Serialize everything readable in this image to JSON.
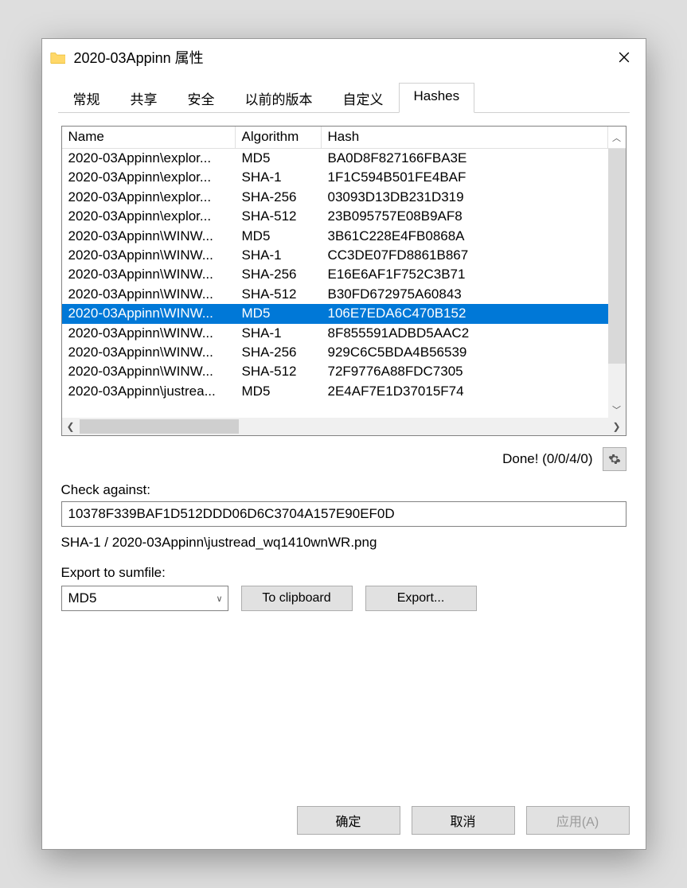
{
  "window": {
    "title": "2020-03Appinn 属性"
  },
  "tabs": [
    "常规",
    "共享",
    "安全",
    "以前的版本",
    "自定义",
    "Hashes"
  ],
  "active_tab_index": 5,
  "list": {
    "headers": {
      "name": "Name",
      "algorithm": "Algorithm",
      "hash": "Hash"
    },
    "selected_index": 8,
    "rows": [
      {
        "name": "2020-03Appinn\\explor...",
        "alg": "MD5",
        "hash": "BA0D8F827166FBA3E"
      },
      {
        "name": "2020-03Appinn\\explor...",
        "alg": "SHA-1",
        "hash": "1F1C594B501FE4BAF"
      },
      {
        "name": "2020-03Appinn\\explor...",
        "alg": "SHA-256",
        "hash": "03093D13DB231D319"
      },
      {
        "name": "2020-03Appinn\\explor...",
        "alg": "SHA-512",
        "hash": "23B095757E08B9AF8"
      },
      {
        "name": "2020-03Appinn\\WINW...",
        "alg": "MD5",
        "hash": "3B61C228E4FB0868A"
      },
      {
        "name": "2020-03Appinn\\WINW...",
        "alg": "SHA-1",
        "hash": "CC3DE07FD8861B867"
      },
      {
        "name": "2020-03Appinn\\WINW...",
        "alg": "SHA-256",
        "hash": "E16E6AF1F752C3B71"
      },
      {
        "name": "2020-03Appinn\\WINW...",
        "alg": "SHA-512",
        "hash": "B30FD672975A60843"
      },
      {
        "name": "2020-03Appinn\\WINW...",
        "alg": "MD5",
        "hash": "106E7EDA6C470B152"
      },
      {
        "name": "2020-03Appinn\\WINW...",
        "alg": "SHA-1",
        "hash": "8F855591ADBD5AAC2"
      },
      {
        "name": "2020-03Appinn\\WINW...",
        "alg": "SHA-256",
        "hash": "929C6C5BDA4B56539"
      },
      {
        "name": "2020-03Appinn\\WINW...",
        "alg": "SHA-512",
        "hash": "72F9776A88FDC7305"
      },
      {
        "name": "2020-03Appinn\\justrea...",
        "alg": "MD5",
        "hash": "2E4AF7E1D37015F74"
      }
    ]
  },
  "status_text": "Done! (0/0/4/0)",
  "check_against": {
    "label": "Check against:",
    "value": "10378F339BAF1D512DDD06D6C3704A157E90EF0D"
  },
  "match_result": "SHA-1 / 2020-03Appinn\\justread_wq1410wnWR.png",
  "export": {
    "label": "Export to sumfile:",
    "selected": "MD5",
    "clipboard_btn": "To clipboard",
    "export_btn": "Export..."
  },
  "footer": {
    "ok": "确定",
    "cancel": "取消",
    "apply": "应用(A)"
  }
}
